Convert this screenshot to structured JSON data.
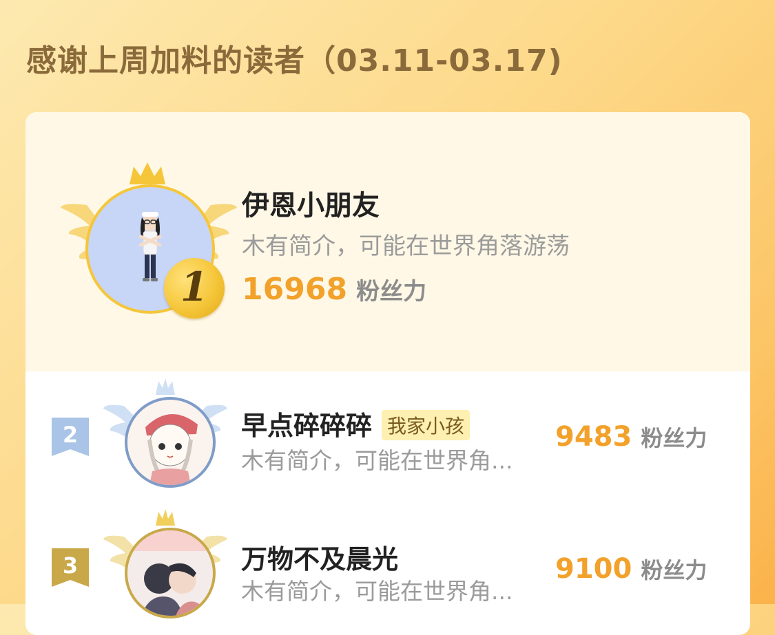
{
  "page": {
    "title": "感谢上周加料的读者（03.11-03.17)"
  },
  "colors": {
    "accent": "#f2a12a",
    "gold": "#f5c63a",
    "silver_blue": "#a9c4e6",
    "bronze": "#c9a84a"
  },
  "top_reader": {
    "rank": "1",
    "name": "伊恩小朋友",
    "intro": "木有简介，可能在世界角落游荡",
    "score": "16968",
    "score_unit": "粉丝力"
  },
  "readers": [
    {
      "rank": "2",
      "name": "早点碎碎碎",
      "tag": "我家小孩",
      "intro": "木有简介，可能在世界角...",
      "score": "9483",
      "score_unit": "粉丝力"
    },
    {
      "rank": "3",
      "name": "万物不及晨光",
      "intro": "木有简介，可能在世界角...",
      "score": "9100",
      "score_unit": "粉丝力"
    }
  ]
}
